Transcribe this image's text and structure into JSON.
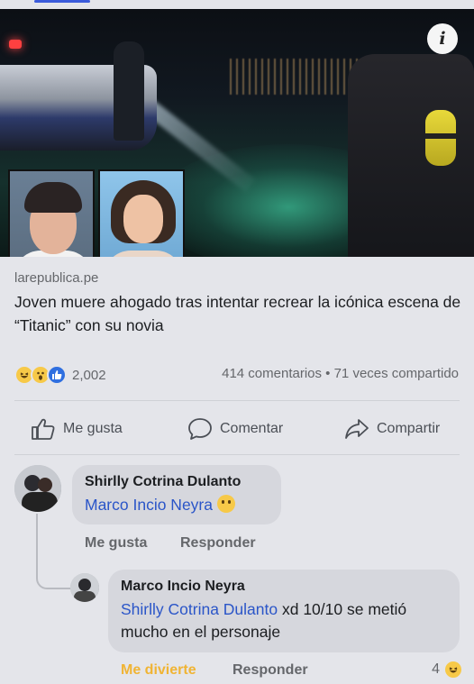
{
  "post": {
    "info_icon": "i",
    "link_domain": "larepublica.pe",
    "headline": "Joven muere ahogado tras intentar recrear la icónica escena de “Titanic” con su novia",
    "reaction_count": "2,002",
    "stats": "414 comentarios • 71 veces compartido",
    "reaction_icons": [
      "haha-icon",
      "wow-icon",
      "like-icon"
    ]
  },
  "actions": {
    "like": "Me gusta",
    "comment": "Comentar",
    "share": "Compartir"
  },
  "comment1": {
    "author": "Shirlly Cotrina Dulanto",
    "mention": "Marco Incio Neyra",
    "like_label": "Me gusta",
    "reply_label": "Responder"
  },
  "comment2": {
    "author": "Marco Incio Neyra",
    "mention": "Shirlly Cotrina Dulanto",
    "text": " xd 10/10 se metió mucho en el personaje",
    "reaction_label": "Me divierte",
    "reply_label": "Responder",
    "reaction_count": "4"
  },
  "colors": {
    "mention": "#2a55c8",
    "haha_reaction_label": "#f0b434",
    "like_blue": "#2f6fe0"
  }
}
